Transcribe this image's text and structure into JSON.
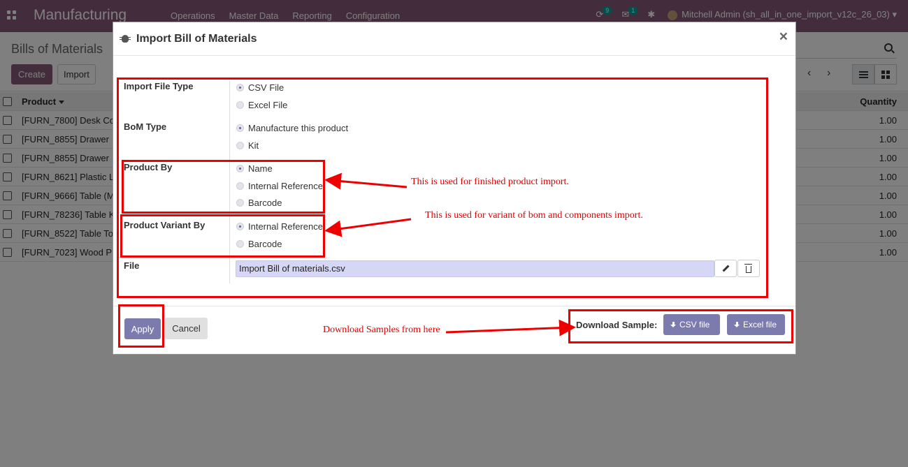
{
  "navbar": {
    "app_name": "Manufacturing",
    "menu": [
      "Operations",
      "Master Data",
      "Reporting",
      "Configuration"
    ],
    "activity_count": "9",
    "message_count": "1",
    "user": "Mitchell Admin (sh_all_in_one_import_v12c_26_03)"
  },
  "control_panel": {
    "title": "Bills of Materials",
    "create_label": "Create",
    "import_label": "Import"
  },
  "list": {
    "columns": {
      "product": "Product",
      "quantity": "Quantity"
    },
    "rows": [
      {
        "product": "[FURN_7800] Desk Co",
        "quantity": "1.00"
      },
      {
        "product": "[FURN_8855] Drawer",
        "quantity": "1.00"
      },
      {
        "product": "[FURN_8855] Drawer",
        "quantity": "1.00"
      },
      {
        "product": "[FURN_8621] Plastic L",
        "quantity": "1.00"
      },
      {
        "product": "[FURN_9666] Table (M",
        "quantity": "1.00"
      },
      {
        "product": "[FURN_78236] Table K",
        "quantity": "1.00"
      },
      {
        "product": "[FURN_8522] Table To",
        "quantity": "1.00"
      },
      {
        "product": "[FURN_7023] Wood P",
        "quantity": "1.00"
      }
    ]
  },
  "modal": {
    "title": "Import Bill of Materials",
    "close_label": "×",
    "fields": {
      "import_file_type": {
        "label": "Import File Type",
        "options": [
          "CSV File",
          "Excel File"
        ],
        "selected": 0
      },
      "bom_type": {
        "label": "BoM Type",
        "options": [
          "Manufacture this product",
          "Kit"
        ],
        "selected": 0
      },
      "product_by": {
        "label": "Product By",
        "options": [
          "Name",
          "Internal Reference",
          "Barcode"
        ],
        "selected": 0
      },
      "product_variant_by": {
        "label": "Product Variant By",
        "options": [
          "Internal Reference",
          "Barcode"
        ],
        "selected": 0
      },
      "file": {
        "label": "File",
        "value": "Import Bill of materials.csv"
      }
    },
    "footer": {
      "apply_label": "Apply",
      "cancel_label": "Cancel",
      "download_label": "Download Sample:",
      "csv_label": "CSV file",
      "excel_label": "Excel file"
    }
  },
  "annotations": {
    "product_by_note": "This is used for finished product import.",
    "variant_note": "This is used for variant of bom and components import.",
    "download_note": "Download Samples from here"
  },
  "colors": {
    "brand": "#875a7b",
    "primary_button": "#7c7bad",
    "file_input_bg": "#d6d6f7",
    "annotation": "#ee0000"
  }
}
